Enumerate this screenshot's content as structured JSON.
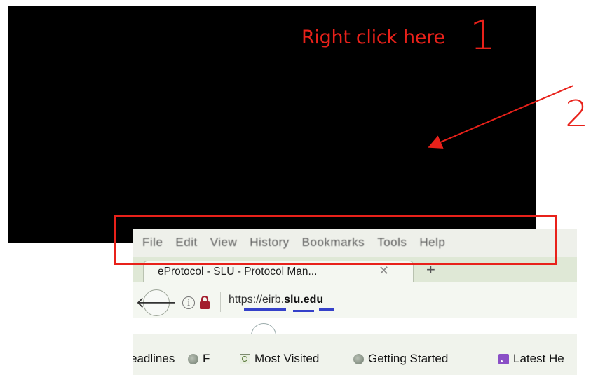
{
  "annotations": {
    "step1_label": "Right click here",
    "step1_number": "1",
    "step2_number": "2",
    "color": "#e8211a"
  },
  "menubar": {
    "items": [
      "File",
      "Edit",
      "View",
      "History",
      "Bookmarks",
      "Tools",
      "Help"
    ]
  },
  "tab": {
    "title": "eProtocol - SLU - Protocol Man...",
    "close_glyph": "✕",
    "new_tab_glyph": "+"
  },
  "navbar": {
    "back_icon": "back-arrow-icon",
    "info_icon": "info-icon",
    "lock_icon": "lock-icon",
    "url_prefix": "https://eirb.",
    "url_host": "slu.edu"
  },
  "bookmarks": {
    "left_partial": [
      "eadlines",
      "F"
    ],
    "items": [
      {
        "label": "Most Visited",
        "icon": "search-icon"
      },
      {
        "label": "Getting Started",
        "icon": "globe-icon"
      },
      {
        "label": "Latest He",
        "icon": "rss-icon"
      }
    ]
  }
}
